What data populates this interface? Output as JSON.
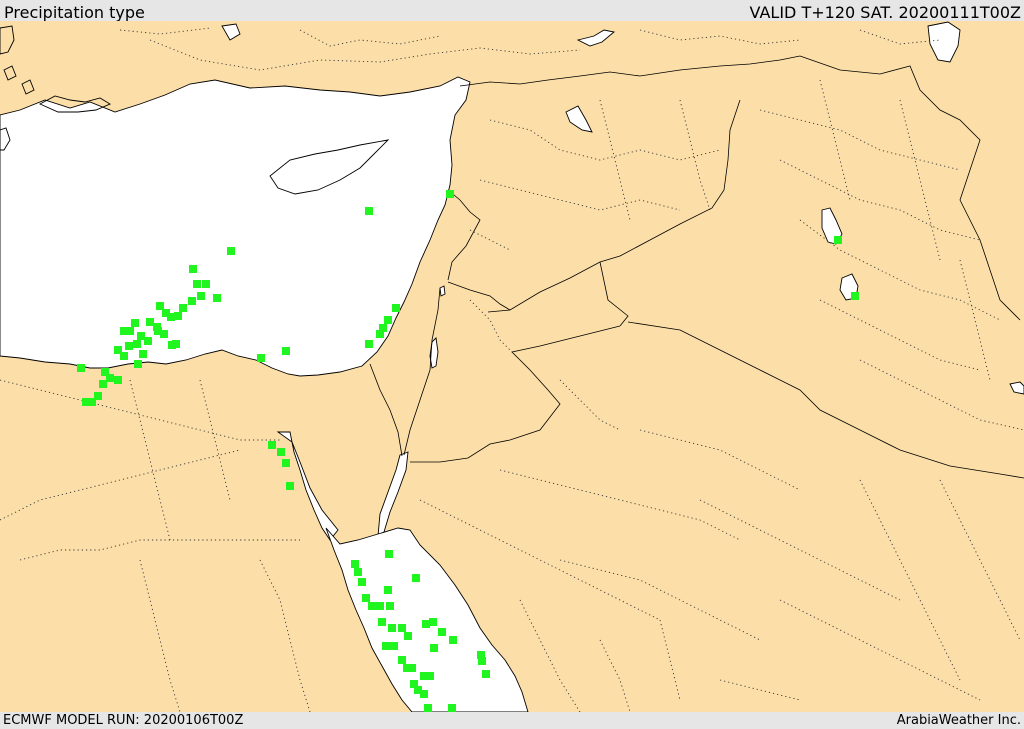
{
  "header": {
    "title": "Precipitation type",
    "valid_time": "VALID T+120 SAT. 20200111T00Z"
  },
  "footer": {
    "model_run": "ECMWF MODEL RUN: 20200106T00Z",
    "credit": "ArabiaWeather Inc."
  },
  "colors": {
    "land": "#fcdfa8",
    "water": "#ffffff",
    "rain": "#20f520",
    "bar": "#e6e6e6"
  },
  "legend": {
    "rain_cells": "rain-icon"
  }
}
